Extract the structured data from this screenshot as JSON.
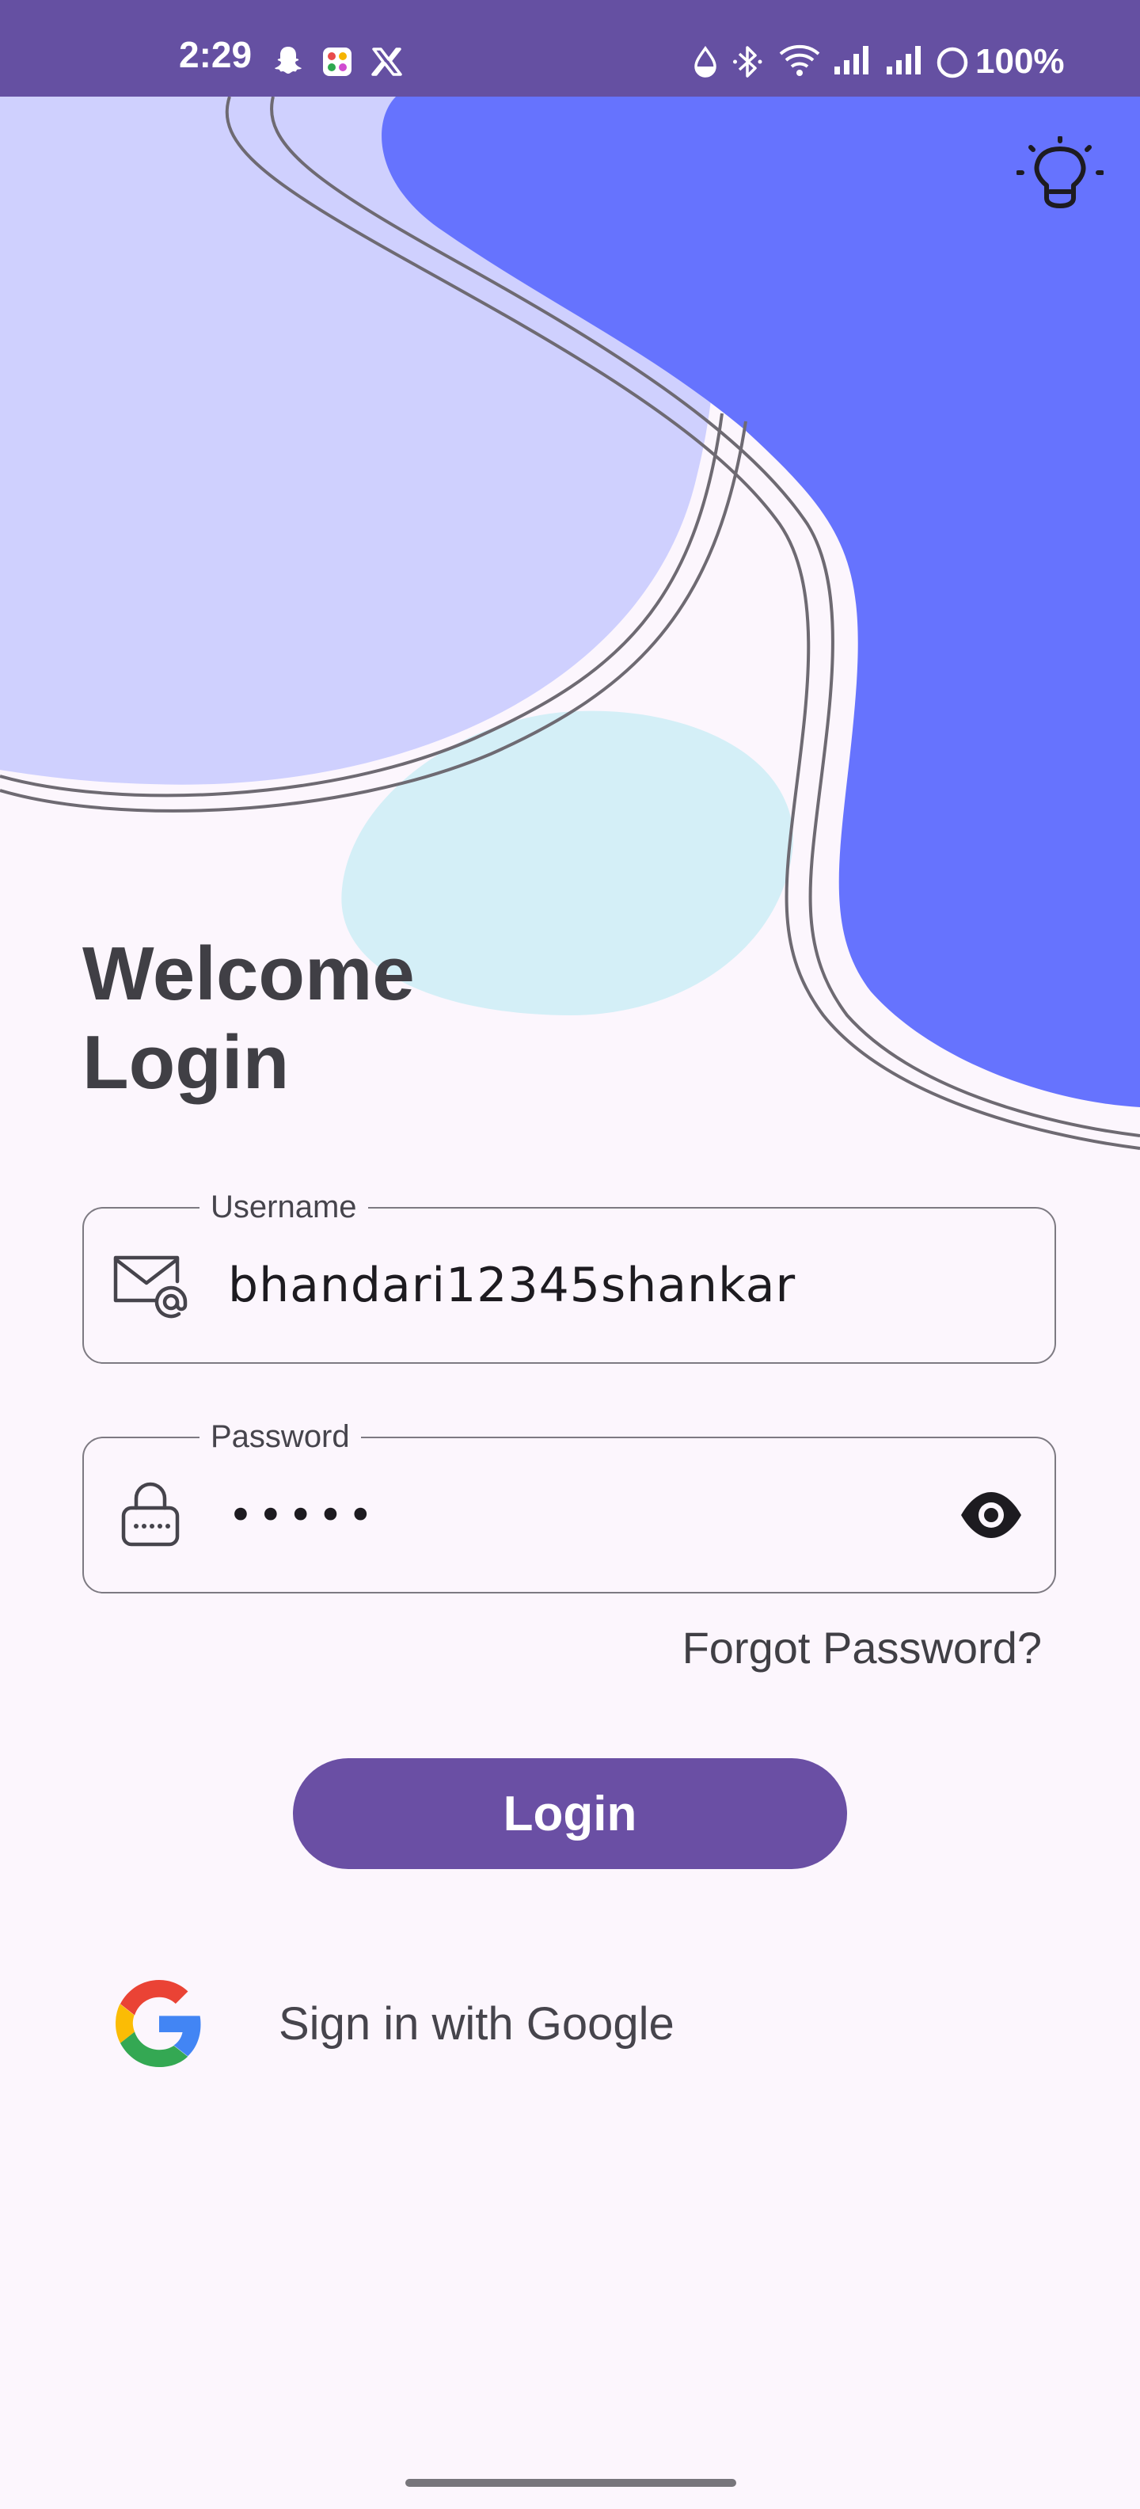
{
  "status_bar": {
    "time": "2:29",
    "battery": "100%",
    "notification_icons": [
      "snapchat-icon",
      "app-icon",
      "x-icon"
    ],
    "system_icons": [
      "data-saver-icon",
      "bluetooth-icon",
      "wifi-icon",
      "signal-icon",
      "signal-icon",
      "battery-ring-icon"
    ]
  },
  "header": {
    "theme_toggle_icon": "lightbulb-icon"
  },
  "headline": {
    "line1": "Welcome",
    "line2": "Login"
  },
  "username": {
    "label": "Username",
    "value": "bhandari12345shankar",
    "icon": "mail-at-icon"
  },
  "password": {
    "label": "Password",
    "value": "•••••",
    "icon": "lock-icon",
    "toggle_icon": "eye-icon"
  },
  "forgot_password": "Forgot Password?",
  "login_button": "Login",
  "google_signin": {
    "label": "Sign in with Google",
    "icon": "google-icon"
  },
  "colors": {
    "status_bar": "#6550a2",
    "background": "#fcf6fd",
    "primary": "#6a4fa4",
    "blob_light": "#cfd0fe",
    "blob_blue": "#6673fe",
    "blob_cyan": "#d4eff7"
  }
}
